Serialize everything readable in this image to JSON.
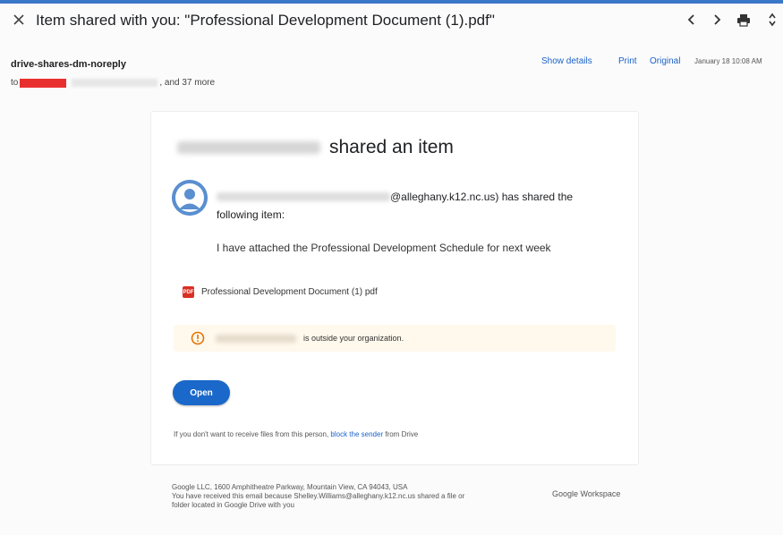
{
  "header": {
    "subject": "Item shared with you: \"Professional Development Document (1).pdf\"",
    "icons": [
      "close-icon",
      "chevron-left-icon",
      "chevron-right-icon",
      "print-icon",
      "expand-collapse-icon"
    ]
  },
  "email": {
    "sender": "drive-shares-dm-noreply",
    "to_prefix": "to",
    "to_suffix": ", and 37 more",
    "show_details": "Show details",
    "print": "Print",
    "original": "Original",
    "date": "January 18 10:08 AM"
  },
  "card": {
    "title": "shared an item",
    "sender_email_suffix": "@alleghany.k12.nc.us) has shared the",
    "sender_line2": "following item:",
    "note": "I have attached the Professional Development Schedule for next week",
    "file_icon_text": "PDF",
    "file_name": "Professional Development Document (1) pdf",
    "warning_text": "is outside your organization.",
    "open_button": "Open",
    "footnote_prefix": "If you don't want to receive files from this person,",
    "footnote_link": "block the sender",
    "footnote_suffix": "from Drive"
  },
  "footer": {
    "address": "Google LLC, 1600 Amphitheatre Parkway, Mountain View, CA 94043, USA",
    "reason_line1": "You have received this email because Shelley.Williams@alleghany.k12.nc.us shared a file or",
    "reason_line2": "folder located in Google Drive with you",
    "brand": "Google Workspace"
  },
  "colors": {
    "accent": "#1a68c9",
    "link": "#1a62c9",
    "redaction": "#e8302f",
    "warning": "#e37400",
    "pdf": "#d93025"
  }
}
